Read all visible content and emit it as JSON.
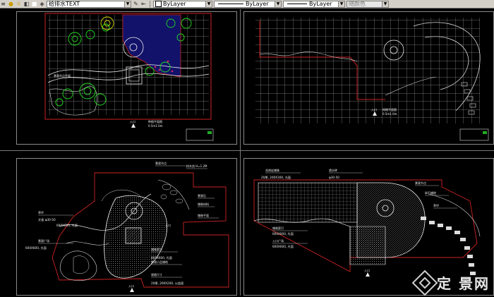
{
  "toolbar": {
    "layer_name": "给排水TEXT",
    "color_value": "ByLayer",
    "linetype_value": "ByLayer",
    "lineweight_value": "ByLayer",
    "plotstyle_value": "随颜色"
  },
  "colors": {
    "background": "#000000",
    "grid": "#ffffff",
    "boundary_red": "#cc2222",
    "tree_green": "#22cc22",
    "water_blue": "#101060",
    "accent_yellow": "#dddd00"
  },
  "viewports": {
    "top_left": {
      "label_north": "入口",
      "scale_title": "种植平面图",
      "scale_ratio": "0.5m1.0m",
      "label_text": "景观节点平面"
    },
    "top_right": {
      "label_north": "入口",
      "scale_title": "网格平面图",
      "scale_ratio": "0.5m1.0m"
    },
    "bottom_left": {
      "label_north": "入口",
      "annotations": [
        "景观节点",
        "树木池 H=1.2M",
        "景观石",
        "铺装材料",
        "铺装平面",
        "铺装索引",
        "景观小品铺地",
        "规格尺寸",
        "草坪",
        "入口",
        "景观广场"
      ],
      "dims": [
        "文板 φ30-50",
        "600X600, 光面",
        "600X600, 光面",
        "800X600, 光面",
        "20厚, 200X200, 火烧面"
      ]
    },
    "bottom_right": {
      "label_north": "入口",
      "annotations": [
        "花岗岩铺装",
        "透水砖",
        "景观节点",
        "碎石铺地",
        "草坪",
        "铺装索引",
        "入口广场"
      ],
      "dims": [
        "20厚, 200X300, 光面",
        "600X600, 光面",
        "600X600, 光面",
        "φ30-50"
      ]
    }
  },
  "watermark": {
    "text": "定 景网"
  }
}
